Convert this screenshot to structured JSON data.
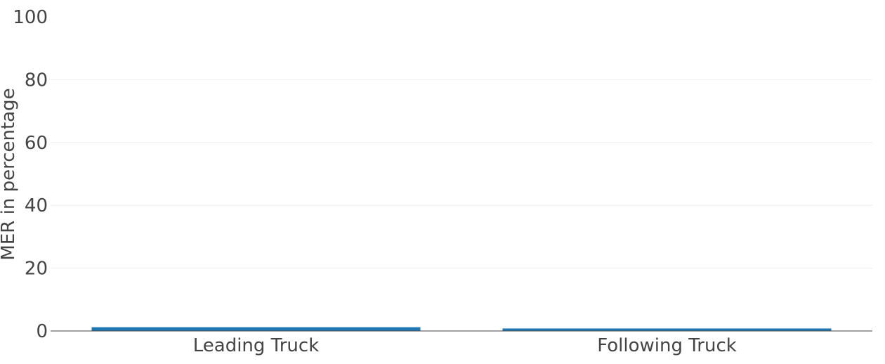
{
  "chart_data": {
    "type": "bar",
    "categories": [
      "Leading Truck",
      "Following Truck"
    ],
    "values": [
      1.2,
      0.8
    ],
    "title": "",
    "xlabel": "",
    "ylabel": "MER in percentage",
    "ylim": [
      0,
      100
    ],
    "yticks": [
      "0",
      "20",
      "40",
      "60",
      "80",
      "100"
    ],
    "grid": true,
    "bar_color": "#1f77b4"
  }
}
